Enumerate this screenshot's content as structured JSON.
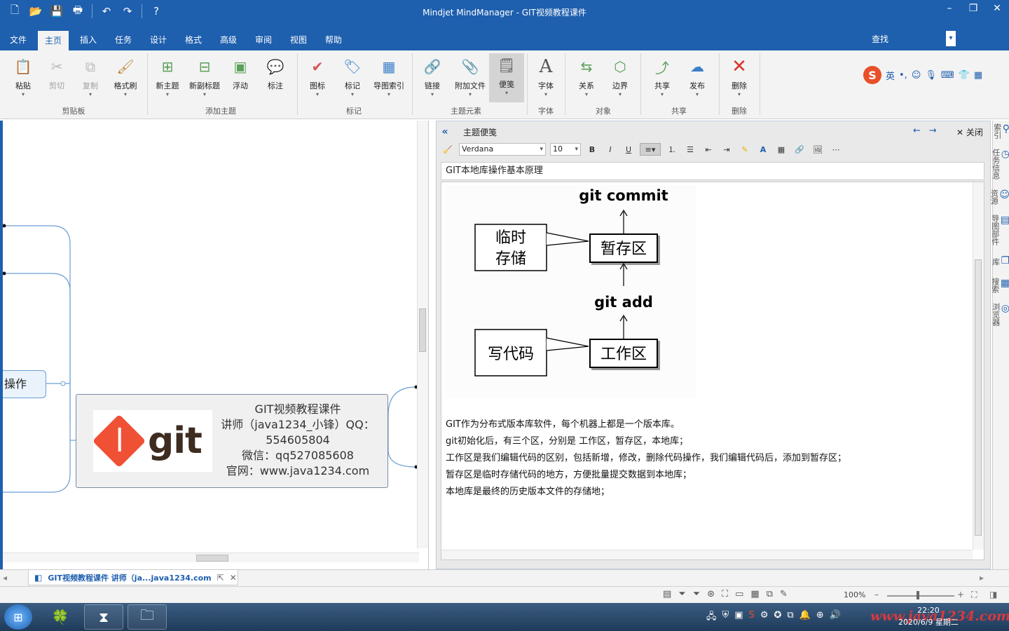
{
  "window": {
    "title": "Mindjet MindManager - GIT视频教程课件"
  },
  "tabs": [
    "文件",
    "主页",
    "插入",
    "任务",
    "设计",
    "格式",
    "高级",
    "审阅",
    "视图",
    "帮助"
  ],
  "active_tab": "主页",
  "search_label": "查找",
  "ribbon": {
    "clipboard": {
      "label": "剪贴板",
      "paste": "粘贴",
      "cut": "剪切",
      "copy": "复制",
      "format_painter": "格式刷"
    },
    "add_topic": {
      "label": "添加主题",
      "new_topic": "新主题",
      "new_subtopic": "新副标题",
      "floating": "浮动",
      "callout": "标注"
    },
    "markers": {
      "label": "标记",
      "icons": "图标",
      "tags": "标记",
      "map_index": "导图索引"
    },
    "topic_elements": {
      "label": "主题元素",
      "link": "链接",
      "attachment": "附加文件",
      "notes": "便笺"
    },
    "font": {
      "label": "字体",
      "font": "字体"
    },
    "objects": {
      "label": "对象",
      "relationship": "关系",
      "boundary": "边界"
    },
    "share": {
      "label": "共享",
      "share": "共享",
      "publish": "发布"
    },
    "delete": {
      "label": "删除",
      "delete": "删除"
    }
  },
  "ime": {
    "lang": "英"
  },
  "map": {
    "topic_fragment": "操作",
    "card_lines": [
      "GIT视频教程课件",
      "讲师（java1234_小锋）QQ：",
      "554605804",
      "微信：qq527085608",
      "官网：www.java1234.com"
    ],
    "logo_word": "git"
  },
  "notes": {
    "header_title": "主题便笺",
    "close_label": "关闭",
    "font_name": "Verdana",
    "font_size": "10",
    "subject": "GIT本地库操作基本原理",
    "diagram": {
      "commit": "git commit",
      "add": "git add",
      "temp_storage": "临时存储",
      "staging": "暂存区",
      "write_code": "写代码",
      "workspace": "工作区"
    },
    "lines": [
      "GIT作为分布式版本库软件，每个机器上都是一个版本库。",
      "git初始化后，有三个区，分别是 工作区，暂存区，本地库；",
      "工作区是我们编辑代码的区别，包括新增，修改，删除代码操作，我们编辑代码后，添加到暂存区；",
      "暂存区是临时存储代码的地方，方便批量提交数据到本地库；",
      "本地库是最终的历史版本文件的存储地；"
    ]
  },
  "side_panels": [
    "索引",
    "任务信息",
    "资源",
    "导图部件",
    "库",
    "搜索",
    "浏览器"
  ],
  "doc_tab": "GIT视频教程课件 讲师（ja...java1234.com",
  "status": {
    "zoom": "100%"
  },
  "taskbar": {
    "time": "22:20",
    "date": "2020/6/9 星期二",
    "watermark": "www.java1234.com"
  }
}
